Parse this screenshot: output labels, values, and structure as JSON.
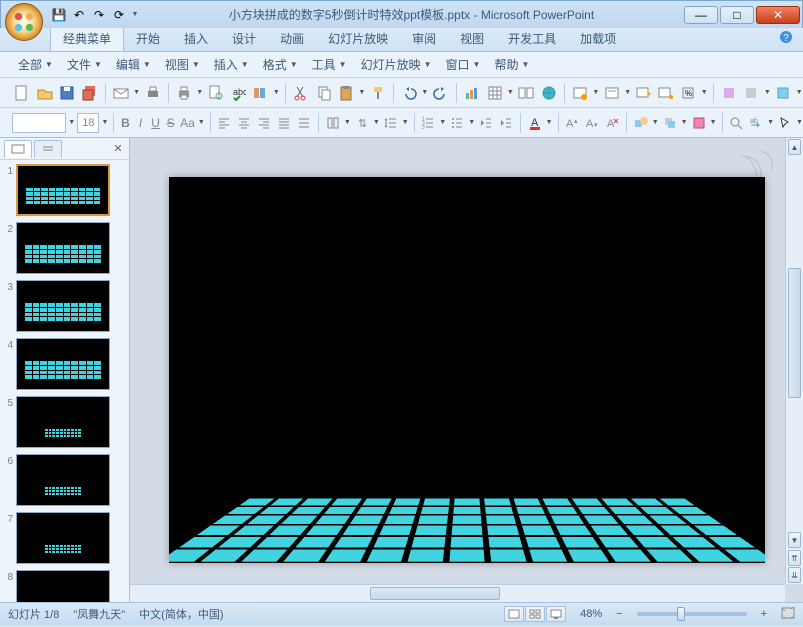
{
  "title": "小方块拼成的数字5秒倒计时特效ppt模板.pptx - Microsoft PowerPoint",
  "ribbon_tabs": [
    "经典菜单",
    "开始",
    "插入",
    "设计",
    "动画",
    "幻灯片放映",
    "审阅",
    "视图",
    "开发工具",
    "加载项"
  ],
  "active_tab_index": 0,
  "menus": [
    "全部",
    "文件",
    "编辑",
    "视图",
    "插入",
    "格式",
    "工具",
    "幻灯片放映",
    "窗口",
    "帮助"
  ],
  "font": {
    "name": "",
    "size": "18"
  },
  "style_labels": {
    "bold": "B",
    "italic": "I",
    "underline": "U",
    "strike": "S",
    "case": "Aa"
  },
  "slides": [
    1,
    2,
    3,
    4,
    5,
    6,
    7,
    8
  ],
  "selected_slide": 1,
  "status": {
    "slide": "幻灯片 1/8",
    "theme": "\"凤舞九天\"",
    "lang": "中文(简体，中国)",
    "zoom": "48%"
  },
  "icons": {
    "save": "💾",
    "undo": "↶",
    "redo": "↷",
    "refresh": "⟳",
    "new": "▫",
    "open": "📂",
    "save2": "💾",
    "saveall": "📑",
    "mail": "✉",
    "print": "🖨",
    "preview": "🔍",
    "spell": "✓",
    "cut": "✂",
    "copy": "📋",
    "paste": "📋",
    "format": "🖌",
    "clear": "✖",
    "chart": "📊",
    "table": "▦",
    "hyperlink": "🔗",
    "shape": "◯",
    "text": "A",
    "newslide": "▭",
    "layout": "▥",
    "run": "▷",
    "fromstart": "▶",
    "help": "?",
    "close_x": "✕",
    "min": "—",
    "max": "□"
  }
}
